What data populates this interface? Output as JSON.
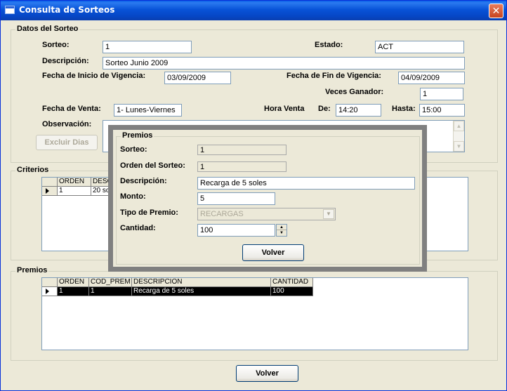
{
  "window": {
    "title": "Consulta de Sorteos",
    "close": "✕"
  },
  "datos": {
    "group_title": "Datos del Sorteo",
    "sorteo_label": "Sorteo:",
    "sorteo_value": "1",
    "estado_label": "Estado:",
    "estado_value": "ACT",
    "descripcion_label": "Descripción:",
    "descripcion_value": "Sorteo Junio 2009",
    "inicio_label": "Fecha de Inicio de Vigencia:",
    "inicio_value": "03/09/2009",
    "fin_label": "Fecha de Fin de Vigencia:",
    "fin_value": "04/09/2009",
    "veces_label": "Veces Ganador:",
    "veces_value": "1",
    "venta_label": "Fecha de Venta:",
    "venta_value": "1- Lunes-Viernes",
    "hora_label": "Hora Venta",
    "de_label": "De:",
    "de_value": "14:20",
    "hasta_label": "Hasta:",
    "hasta_value": "15:00",
    "observacion_label": "Observación:",
    "excluir_label": "Excluir Dias"
  },
  "criterios": {
    "group_title": "Criterios",
    "columns": [
      "ORDEN",
      "DESC"
    ],
    "rows": [
      [
        "1",
        "20 so"
      ]
    ]
  },
  "premios_grid": {
    "group_title": "Premios",
    "columns": [
      "ORDEN",
      "COD_PREM",
      "DESCRIPCION",
      "CANTIDAD"
    ],
    "rows": [
      [
        "1",
        "1",
        "Recarga de 5 soles",
        "100"
      ]
    ]
  },
  "footer": {
    "volver_label": "Volver"
  },
  "modal": {
    "group_title": "Premios",
    "sorteo_label": "Sorteo:",
    "sorteo_value": "1",
    "orden_label": "Orden del Sorteo:",
    "orden_value": "1",
    "descripcion_label": "Descripción:",
    "descripcion_value": "Recarga de 5 soles",
    "monto_label": "Monto:",
    "monto_value": "5",
    "tipo_label": "Tipo de Premio:",
    "tipo_value": "RECARGAS",
    "cantidad_label": "Cantidad:",
    "cantidad_value": "100",
    "volver_label": "Volver"
  },
  "icons": {
    "row_pointer": "row-pointer-icon",
    "combo": "chevron-down-icon",
    "spin_up": "▲",
    "spin_down": "▼",
    "scroll_up": "▲",
    "scroll_down": "▼"
  }
}
